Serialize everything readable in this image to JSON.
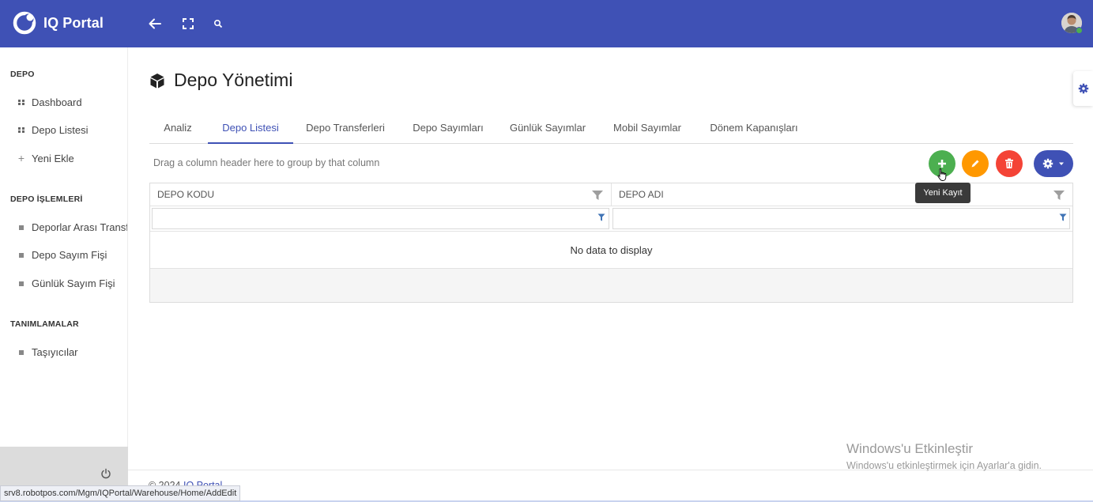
{
  "topbar": {
    "brand": "IQ Portal",
    "icons": [
      "back-arrow-icon",
      "fullscreen-icon",
      "search-icon"
    ]
  },
  "sidebar": {
    "sections": [
      {
        "title": "DEPO",
        "items": [
          {
            "label": "Dashboard",
            "icon": "grid-icon"
          },
          {
            "label": "Depo Listesi",
            "icon": "grid-icon"
          },
          {
            "label": "Yeni Ekle",
            "icon": "plus-icon"
          }
        ]
      },
      {
        "title": "DEPO İŞLEMLERİ",
        "items": [
          {
            "label": "Deporlar Arası Transfer",
            "icon": "square-icon"
          },
          {
            "label": "Depo Sayım Fişi",
            "icon": "square-icon"
          },
          {
            "label": "Günlük Sayım Fişi",
            "icon": "square-icon"
          }
        ]
      },
      {
        "title": "TANIMLAMALAR",
        "items": [
          {
            "label": "Taşıyıcılar",
            "icon": "square-icon"
          }
        ]
      }
    ]
  },
  "main": {
    "title": "Depo Yönetimi",
    "tabs": [
      {
        "label": "Analiz"
      },
      {
        "label": "Depo Listesi",
        "active": true
      },
      {
        "label": "Depo Transferleri"
      },
      {
        "label": "Depo Sayımları"
      },
      {
        "label": "Günlük Sayımlar"
      },
      {
        "label": "Mobil Sayımlar"
      },
      {
        "label": "Dönem Kapanışları"
      }
    ],
    "group_hint": "Drag a column header here to group by that column",
    "tooltip": "Yeni Kayıt",
    "grid": {
      "columns": [
        "DEPO KODU",
        "DEPO ADI"
      ],
      "empty_text": "No data to display"
    }
  },
  "colors": {
    "primary": "#3f51b5",
    "add": "#4caf50",
    "edit": "#ff9800",
    "delete": "#f44336"
  },
  "footer": {
    "copyright_prefix": "© 2024 ",
    "copyright_link": "IQ Portal"
  },
  "windows_watermark": {
    "line1": "Windows'u Etkinleştir",
    "line2": "Windows'u etkinleştirmek için Ayarlar'a gidin."
  },
  "status_url": "srv8.robotpos.com/Mgm/IQPortal/Warehouse/Home/AddEdit"
}
